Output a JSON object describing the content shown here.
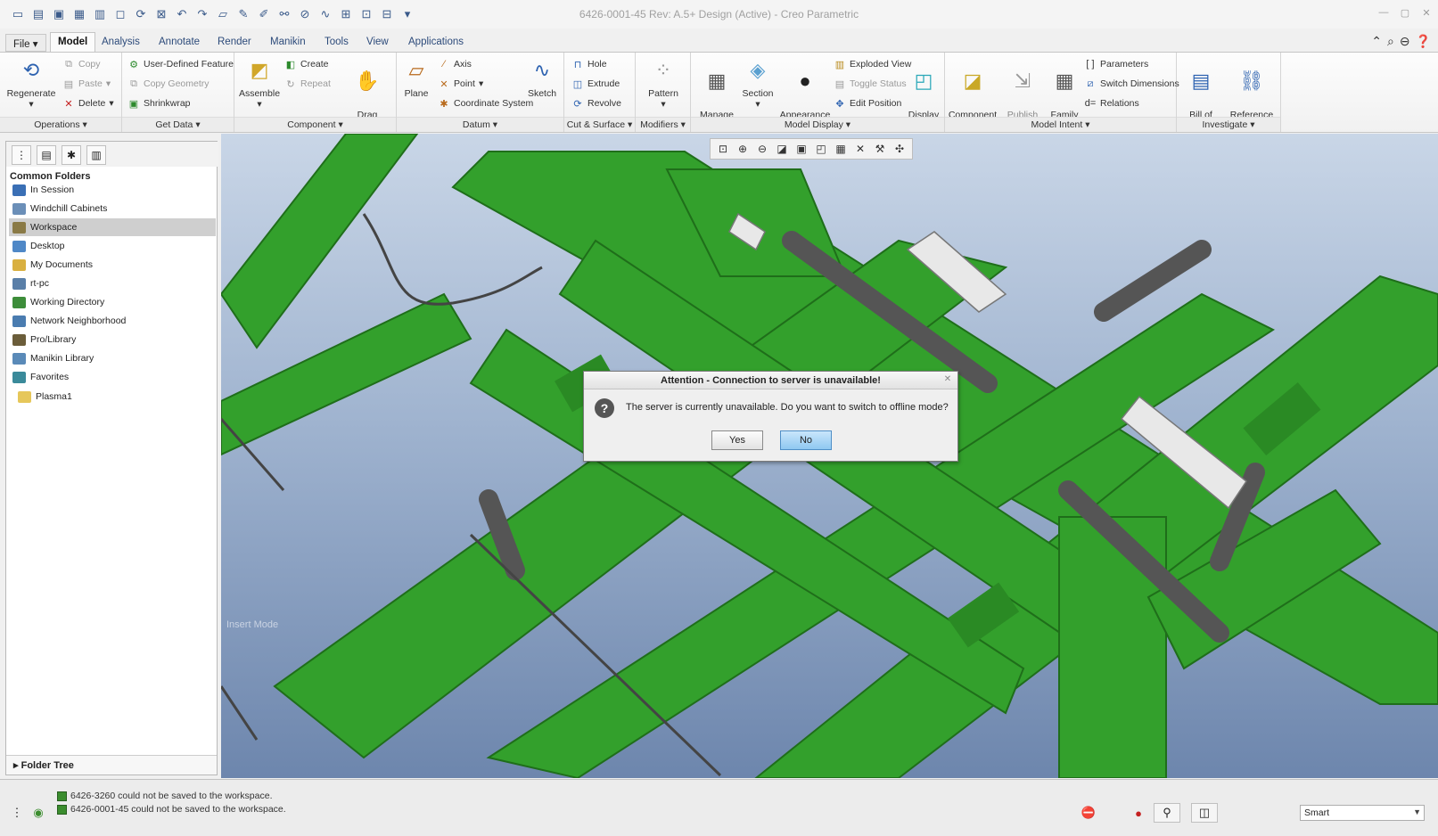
{
  "window": {
    "title": "6426-0001-45 Rev: A.5+ Design  (Active) - Creo Parametric"
  },
  "quick_access": [
    "new-icon",
    "open-icon",
    "save-icon",
    "save-as-icon",
    "print-icon",
    "window-icon",
    "regenerate-icon",
    "close-window-icon",
    "undo-icon",
    "redo-icon",
    "folder-icon",
    "sketch-icon",
    "edit-icon",
    "relations-icon",
    "measure-icon",
    "axis-icon",
    "display-icon",
    "zoom-icon",
    "screen-icon",
    "more-icon"
  ],
  "tabs": [
    "File",
    "Model",
    "Analysis",
    "Annotate",
    "Render",
    "Manikin",
    "Tools",
    "View",
    "Applications"
  ],
  "active_tab": "Model",
  "ribbon": {
    "operations": {
      "label": "Operations",
      "regenerate": "Regenerate",
      "copy": "Copy",
      "paste": "Paste",
      "delete": "Delete"
    },
    "get_data": {
      "label": "Get Data",
      "udf": "User-Defined Feature",
      "copy_geometry": "Copy Geometry",
      "shrinkwrap": "Shrinkwrap"
    },
    "component": {
      "label": "Component",
      "assemble": "Assemble",
      "create": "Create",
      "repeat": "Repeat",
      "drag": "Drag\nComponents"
    },
    "datum": {
      "label": "Datum",
      "plane": "Plane",
      "axis": "Axis",
      "point": "Point",
      "csys": "Coordinate System",
      "sketch": "Sketch"
    },
    "cut_surface": {
      "label": "Cut & Surface",
      "hole": "Hole",
      "extrude": "Extrude",
      "revolve": "Revolve"
    },
    "modifiers": {
      "label": "Modifiers",
      "pattern": "Pattern"
    },
    "model_display": {
      "label": "Model Display",
      "manage_views": "Manage\nViews",
      "section": "Section",
      "appearance": "Appearance\nGallery",
      "exploded": "Exploded View",
      "toggle_status": "Toggle Status",
      "edit_position": "Edit Position",
      "display_style": "Display\nStyle"
    },
    "model_intent": {
      "label": "Model Intent",
      "component_interface": "Component\nInterface",
      "publish_geometry": "Publish\nGeometry",
      "family_table": "Family\nTable",
      "parameters": "Parameters",
      "switch_dimensions": "Switch Dimensions",
      "relations": "Relations"
    },
    "investigate": {
      "label": "Investigate",
      "bom": "Bill of\nMaterials",
      "reference_viewer": "Reference\nViewer"
    }
  },
  "left_panel": {
    "heading": "Common Folders",
    "folders": [
      {
        "label": "In Session",
        "color": "#3a6fb5"
      },
      {
        "label": "Windchill Cabinets",
        "color": "#6b8fb8"
      },
      {
        "label": "Workspace",
        "color": "#8a7a46"
      },
      {
        "label": "Desktop",
        "color": "#4f88c7"
      },
      {
        "label": "My Documents",
        "color": "#d9b040"
      },
      {
        "label": "rt-pc",
        "color": "#5a7fa8"
      },
      {
        "label": "Working Directory",
        "color": "#3d8d3a"
      },
      {
        "label": "Network Neighborhood",
        "color": "#4a7cb0"
      },
      {
        "label": "Pro/Library",
        "color": "#6b5d3a"
      },
      {
        "label": "Manikin Library",
        "color": "#5a8ab8"
      },
      {
        "label": "Favorites",
        "color": "#3a8a9a"
      },
      {
        "label": "Plasma1",
        "color": "#e6c75a"
      }
    ],
    "selected": "Workspace",
    "folder_tree": "Folder Tree"
  },
  "viewport": {
    "insert_mode": "Insert Mode"
  },
  "dialog": {
    "title": "Attention - Connection to server is unavailable!",
    "message": "The server is currently unavailable. Do you want to switch to offline mode?",
    "yes": "Yes",
    "no": "No"
  },
  "status": {
    "messages": [
      "6426-3260 could not be saved to the workspace.",
      "6426-0001-45 could not be saved to the workspace."
    ],
    "filter": "Smart"
  },
  "colors": {
    "model_green": "#33a02c",
    "model_dark_green": "#1f6e1a",
    "accent_blue": "#2c4a7a"
  }
}
